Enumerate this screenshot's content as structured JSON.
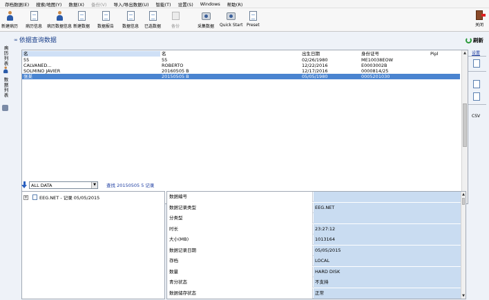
{
  "menubar": [
    "存档数据(E)",
    "搜索/地图(Y)",
    "数据(X)",
    "备份(V)",
    "导入/导出数据(U)",
    "智能(T)",
    "设置(S)",
    "Windows",
    "帮助(R)"
  ],
  "toolbar": [
    {
      "label": "新建病历",
      "icon": "person-icon"
    },
    {
      "label": "病历信息",
      "icon": "document-icon"
    },
    {
      "label": "病历数据信息",
      "icon": "person-icon"
    },
    {
      "label": "新建数据",
      "icon": "document-icon"
    },
    {
      "label": "数据报告",
      "icon": "document-icon"
    },
    {
      "label": "数据信息",
      "icon": "document-icon"
    },
    {
      "label": "已选数据",
      "icon": "document-icon"
    },
    {
      "label": "备份",
      "icon": "gray-icon"
    },
    {
      "label": "采集数据",
      "icon": "camera-icon"
    },
    {
      "label": "Quick Start",
      "icon": "camera-icon"
    },
    {
      "label": "Preset",
      "icon": "document-icon"
    }
  ],
  "exit_label": "关闭",
  "left_rail": {
    "tab1": "病历列表",
    "tab2": "数据列表"
  },
  "right_rail": {
    "refresh": "刷新",
    "settings": "设置",
    "csv": "CSV"
  },
  "page_title": "依据查询数据",
  "results": {
    "headers": {
      "id": "名",
      "name": "名",
      "date": "出生日期",
      "idno": "身份证号",
      "pipl": "Pipl"
    },
    "rows": [
      {
        "id": "55",
        "name": "55",
        "date": "02/26/1980",
        "idno": "ME10038EOW",
        "selected": false
      },
      {
        "id": "CALVANED...",
        "name": "ROBERTO",
        "date": "12/22/2016",
        "idno": "E0003002B",
        "selected": false
      },
      {
        "id": "SOLMINO JAVIER",
        "name": "20160505 B",
        "date": "12/17/2016",
        "idno": "0000814/25",
        "selected": false
      },
      {
        "id": "张某",
        "name": "20150505 B",
        "date": "05/05/1980",
        "idno": "0005201030",
        "selected": true
      }
    ]
  },
  "filter": {
    "value": "ALL DATA",
    "count_text": "查找 20150505 5 记录"
  },
  "tree": {
    "node_label": "EEG.NET - 记录 05/05/2015"
  },
  "props": [
    {
      "key": "数据编号",
      "value": ""
    },
    {
      "key": "数据记录类型",
      "value": "EEG.NET"
    },
    {
      "key": "分类型",
      "value": ""
    },
    {
      "key": "时长",
      "value": "23:27:12"
    },
    {
      "key": "大小(MB)",
      "value": "1013164"
    },
    {
      "key": "数据记录日期",
      "value": "05/05/2015"
    },
    {
      "key": "存档",
      "value": "LOCAL"
    },
    {
      "key": "数量",
      "value": "HARD DISK"
    },
    {
      "key": "青分状态",
      "value": "不支持"
    },
    {
      "key": "数据储存状态",
      "value": "正常"
    }
  ]
}
